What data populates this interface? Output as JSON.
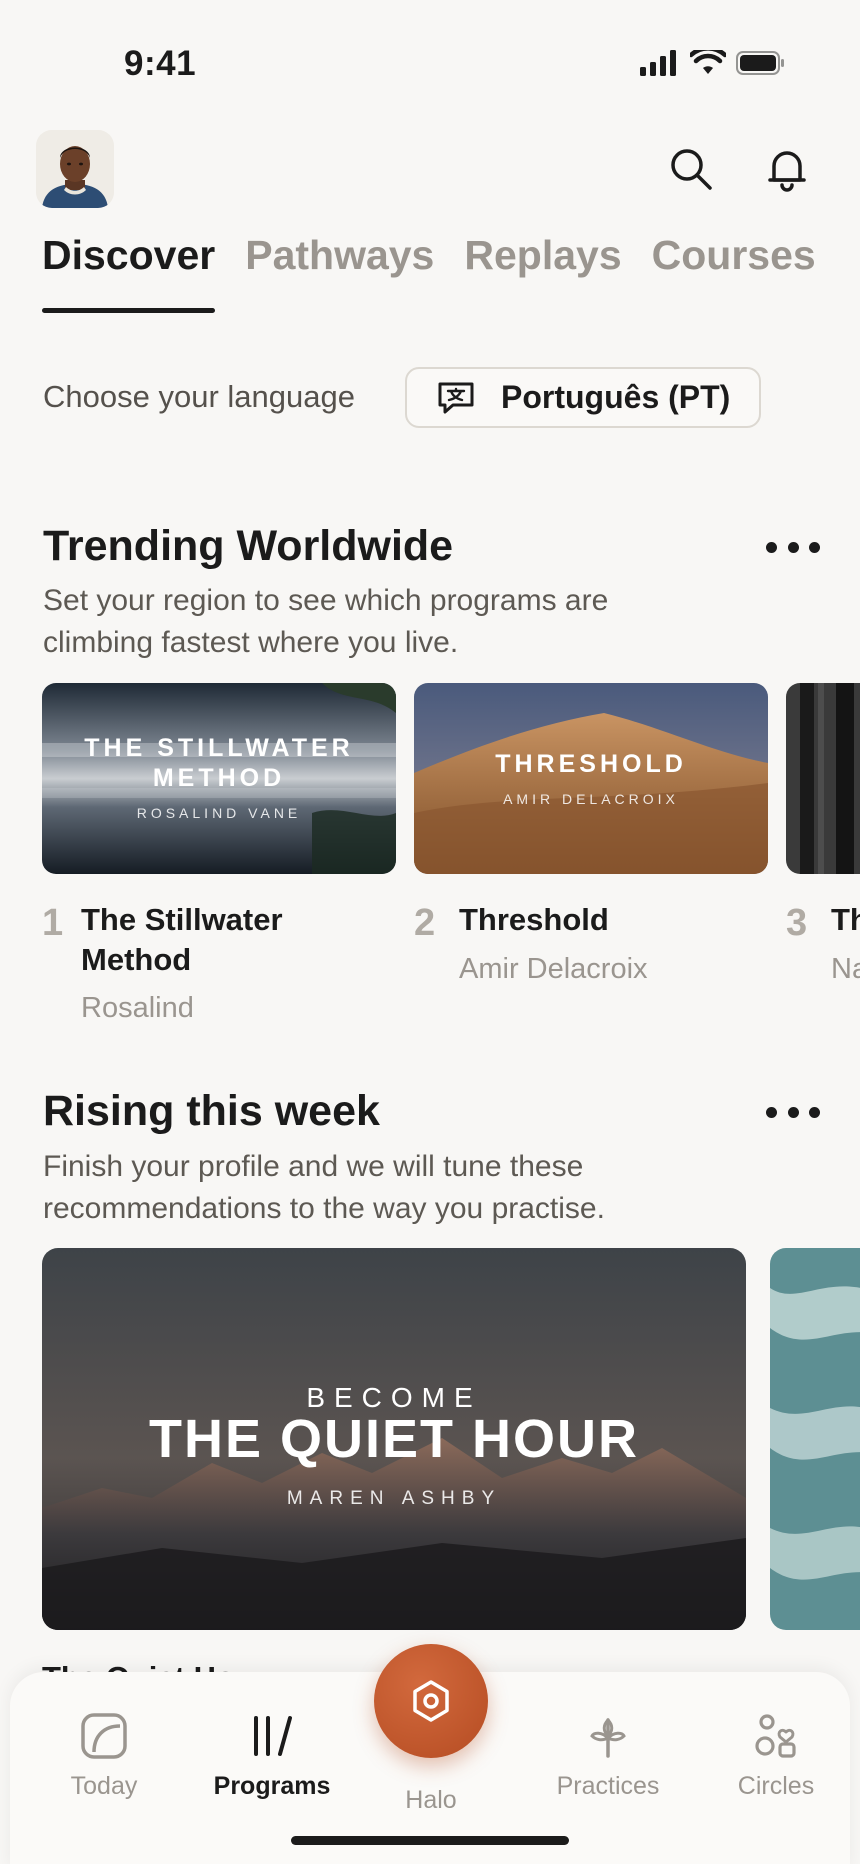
{
  "status_bar": {
    "time": "9:41"
  },
  "tabs": [
    {
      "label": "Discover",
      "active": true
    },
    {
      "label": "Pathways",
      "active": false
    },
    {
      "label": "Replays",
      "active": false
    },
    {
      "label": "Courses",
      "active": false
    }
  ],
  "language": {
    "label": "Choose your language",
    "value": "Português (PT)"
  },
  "trending": {
    "title": "Trending Worldwide",
    "subtitle": "Set your region to see which programs are climbing fastest where you live.",
    "items": [
      {
        "rank": "1",
        "cover_title": "THE STILLWATER METHOD",
        "cover_author": "ROSALIND VANE",
        "title": "The Stillwater Method",
        "author": "Rosalind"
      },
      {
        "rank": "2",
        "cover_title": "THRESHOLD",
        "cover_author": "AMIR DELACROIX",
        "title": "Threshold",
        "author": "Amir Delacroix"
      },
      {
        "rank": "3",
        "title": "Th",
        "author": "Na"
      }
    ]
  },
  "rising": {
    "title": "Rising this week",
    "subtitle": "Finish your profile and we will tune these recommendations to the way you practise.",
    "featured": {
      "overline": "BECOME",
      "title": "THE QUIET HOUR",
      "author": "MAREN ASHBY"
    }
  },
  "bottom_nav": {
    "items": [
      {
        "label": "Today",
        "icon": "today-icon",
        "active": false
      },
      {
        "label": "Programs",
        "icon": "programs-icon",
        "active": true
      },
      {
        "label": "Halo",
        "icon": "halo-icon",
        "active": false
      },
      {
        "label": "Practices",
        "icon": "practices-icon",
        "active": false
      },
      {
        "label": "Circles",
        "icon": "circles-icon",
        "active": false
      }
    ]
  },
  "colors": {
    "accent": "#c15a2e",
    "text": "#1b1b1b",
    "muted": "#9a958f",
    "background": "#f8f7f5"
  }
}
